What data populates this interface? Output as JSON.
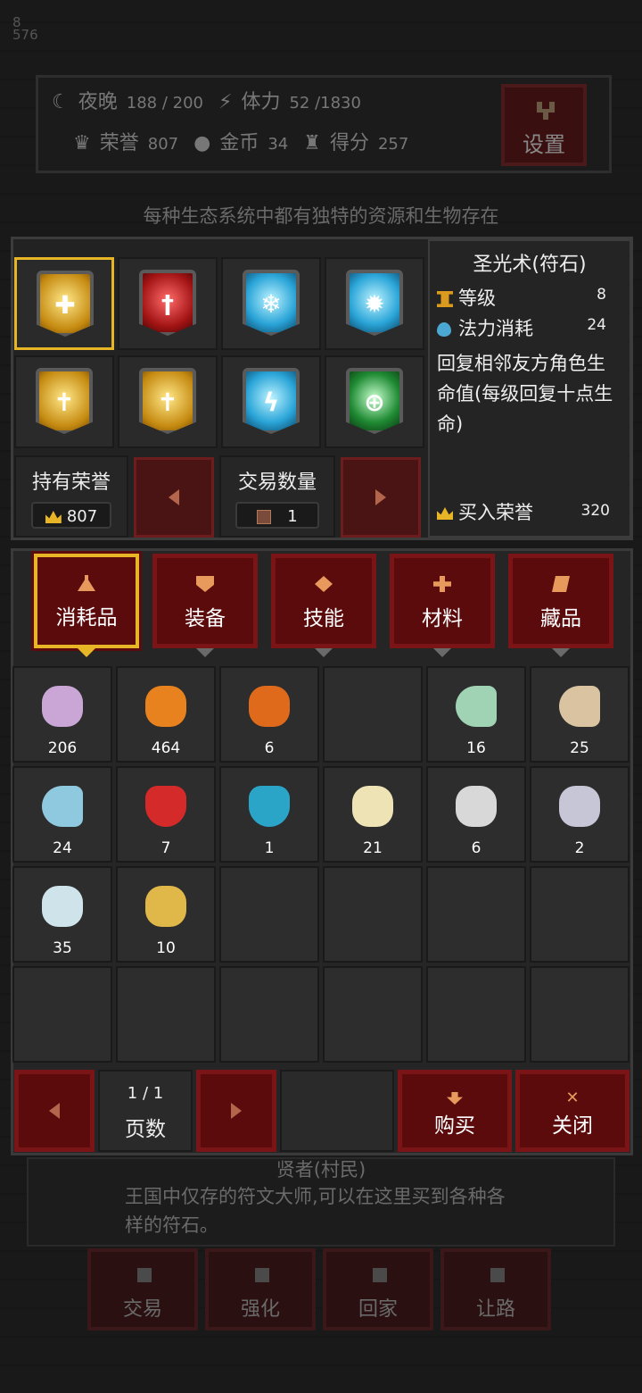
{
  "hud": {
    "night_label": "夜晚",
    "night_value": "188 / 200",
    "stamina_label": "体力",
    "stamina_value": "52 /1830",
    "honor_label": "荣誉",
    "honor_value": "807",
    "gold_label": "金币",
    "gold_value": "34",
    "score_label": "得分",
    "score_value": "257",
    "settings_label": "设置",
    "side_top": "8",
    "side_small": "576"
  },
  "banner": "每种生态系统中都有独特的资源和生物存在",
  "runes": [
    {
      "icon": "healing-rune-icon",
      "color": "gold",
      "glyph": "✚"
    },
    {
      "icon": "sword-rune-icon",
      "color": "red",
      "glyph": "†"
    },
    {
      "icon": "frost-totem-rune-icon",
      "color": "blue",
      "glyph": "❄"
    },
    {
      "icon": "ice-spirit-rune-icon",
      "color": "blue",
      "glyph": "✹"
    },
    {
      "icon": "holy-cross-rune-icon",
      "color": "gold",
      "glyph": "✝"
    },
    {
      "icon": "holy-cross-rune-icon",
      "color": "gold",
      "glyph": "✝"
    },
    {
      "icon": "lightning-rune-icon",
      "color": "blue",
      "glyph": "ϟ"
    },
    {
      "icon": "nature-ring-rune-icon",
      "color": "green",
      "glyph": "⊕"
    }
  ],
  "held_honor": {
    "label": "持有荣誉",
    "value": "807"
  },
  "trade_qty": {
    "label": "交易数量",
    "value": "1"
  },
  "detail": {
    "name": "圣光术(符石)",
    "level_label": "等级",
    "level_value": "8",
    "mana_label": "法力消耗",
    "mana_value": "24",
    "description": "回复相邻友方角色生命值(每级回复十点生命)",
    "buy_label": "买入荣誉",
    "buy_value": "320"
  },
  "categories": [
    {
      "label": "消耗品",
      "selected": true
    },
    {
      "label": "装备",
      "selected": false
    },
    {
      "label": "技能",
      "selected": false
    },
    {
      "label": "材料",
      "selected": false
    },
    {
      "label": "藏品",
      "selected": false
    }
  ],
  "items": [
    {
      "icon": "turnip-icon",
      "qty": "206",
      "color": "#c9a6d6"
    },
    {
      "icon": "pumpkin-icon",
      "qty": "464",
      "color": "#e8821e"
    },
    {
      "icon": "cake-icon",
      "qty": "6",
      "color": "#e06a1c"
    },
    {
      "icon": "",
      "qty": "",
      "color": ""
    },
    {
      "icon": "green-fish-icon",
      "qty": "16",
      "color": "#9fd3b3"
    },
    {
      "icon": "tan-fish-icon",
      "qty": "25",
      "color": "#d9c3a0"
    },
    {
      "icon": "blue-fish-icon",
      "qty": "24",
      "color": "#8fc9e0"
    },
    {
      "icon": "red-potion-icon",
      "qty": "7",
      "color": "#d42a2a"
    },
    {
      "icon": "blue-potion-icon",
      "qty": "1",
      "color": "#2aa5c8"
    },
    {
      "icon": "jar-icon",
      "qty": "21",
      "color": "#eee3b5"
    },
    {
      "icon": "bone-icon",
      "qty": "6",
      "color": "#d8d8d8"
    },
    {
      "icon": "crown-icon",
      "qty": "2",
      "color": "#c6c6d6"
    },
    {
      "icon": "winged-statue-icon",
      "qty": "35",
      "color": "#cfe3ea"
    },
    {
      "icon": "gold-compass-icon",
      "qty": "10",
      "color": "#e0b84a"
    }
  ],
  "pager": {
    "page": "1 / 1",
    "label": "页数"
  },
  "buy_label": "购买",
  "close_label": "关闭",
  "npc": {
    "name": "贤者(村民)",
    "desc": "王国中仅存的符文大师,可以在这里买到各种各样的符石。"
  },
  "actions": [
    "交易",
    "强化",
    "回家",
    "让路"
  ]
}
